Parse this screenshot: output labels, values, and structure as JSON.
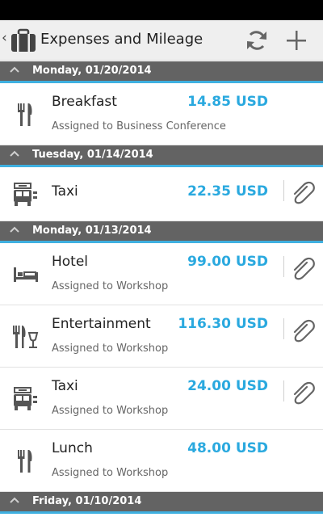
{
  "app": {
    "title": "Expenses and Mileage",
    "back_glyph": "‹",
    "logo_icon": "briefcase-icon",
    "actions": [
      {
        "name": "sync-icon",
        "label": "Sync"
      },
      {
        "name": "add-icon",
        "label": "Add"
      }
    ]
  },
  "colors": {
    "accent": "#2aa9df",
    "section_header": "#636363",
    "section_underline": "#3fb0e0",
    "action_bar": "#efefef"
  },
  "sections": [
    {
      "date": "Monday, 01/20/2014",
      "items": [
        {
          "icon": "fork-knife-icon",
          "name": "Breakfast",
          "amount": "14.85 USD",
          "assignment": "Assigned to Business Conference",
          "attachment": false
        }
      ]
    },
    {
      "date": "Tuesday, 01/14/2014",
      "items": [
        {
          "icon": "taxi-icon",
          "name": "Taxi",
          "amount": "22.35 USD",
          "assignment": "",
          "attachment": true
        }
      ]
    },
    {
      "date": "Monday, 01/13/2014",
      "items": [
        {
          "icon": "bed-icon",
          "name": "Hotel",
          "amount": "99.00 USD",
          "assignment": "Assigned to Workshop",
          "attachment": true
        },
        {
          "icon": "entertainment-icon",
          "name": "Entertainment",
          "amount": "116.30 USD",
          "assignment": "Assigned to Workshop",
          "attachment": true
        },
        {
          "icon": "taxi-icon",
          "name": "Taxi",
          "amount": "24.00 USD",
          "assignment": "Assigned to Workshop",
          "attachment": true
        },
        {
          "icon": "fork-knife-icon",
          "name": "Lunch",
          "amount": "48.00 USD",
          "assignment": "Assigned to Workshop",
          "attachment": false
        }
      ]
    },
    {
      "date": "Friday, 01/10/2014",
      "items": []
    }
  ]
}
